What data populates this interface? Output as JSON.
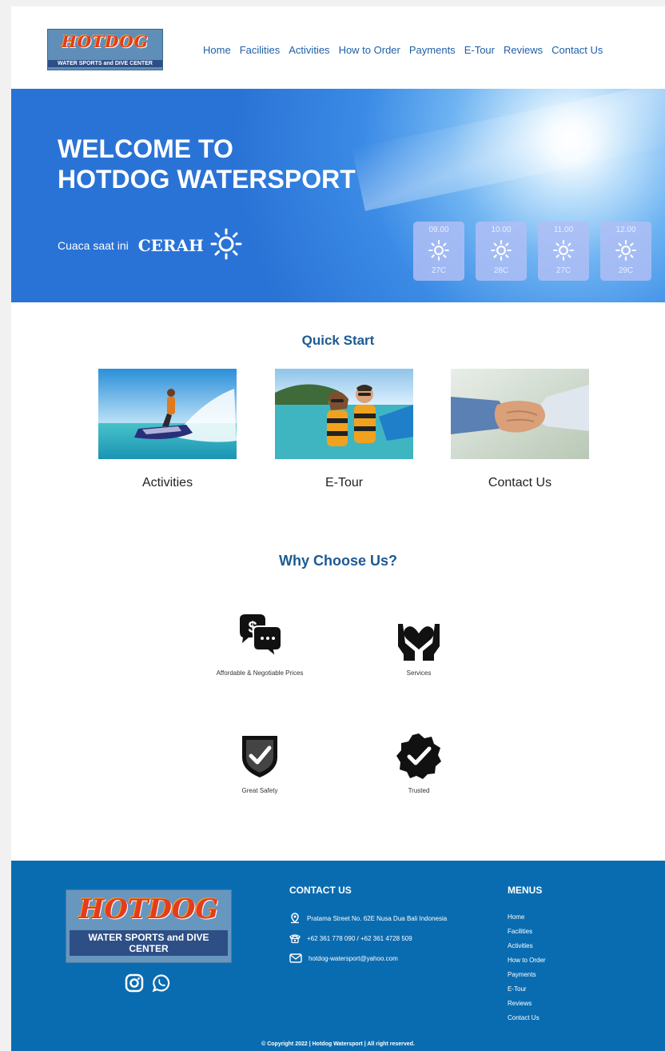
{
  "header": {
    "logo": {
      "brand": "HOTDOG",
      "subtitle": "WATER SPORTS and DIVE CENTER"
    },
    "nav": [
      "Home",
      "Facilities",
      "Activities",
      "How to Order",
      "Payments",
      "E-Tour",
      "Reviews",
      "Contact Us"
    ]
  },
  "hero": {
    "title_line1": "WELCOME TO",
    "title_line2": "HOTDOG WATERSPORT",
    "weather_label": "Cuaca saat ini",
    "weather_value": "CERAH",
    "weather_icon": "sun-icon",
    "forecast": [
      {
        "time": "09.00",
        "temp": "27C"
      },
      {
        "time": "10.00",
        "temp": "28C"
      },
      {
        "time": "11.00",
        "temp": "27C"
      },
      {
        "time": "12.00",
        "temp": "29C"
      }
    ]
  },
  "quick_start": {
    "title": "Quick Start",
    "cards": [
      {
        "label": "Activities"
      },
      {
        "label": "E-Tour"
      },
      {
        "label": "Contact Us"
      }
    ]
  },
  "why_choose_us": {
    "title": "Why Choose Us?",
    "features": [
      {
        "icon": "price-chat-icon",
        "label": "Affordable & Negotiable Prices"
      },
      {
        "icon": "heart-hands-icon",
        "label": "Services"
      },
      {
        "icon": "shield-check-icon",
        "label": "Great Safety"
      },
      {
        "icon": "verified-badge-icon",
        "label": "Trusted"
      }
    ]
  },
  "footer": {
    "logo": {
      "brand": "HOTDOG",
      "subtitle": "WATER SPORTS and DIVE CENTER"
    },
    "social": [
      "instagram-icon",
      "whatsapp-icon"
    ],
    "contact_title": "CONTACT US",
    "address": "Pratama Street No. 62E Nusa Dua Bali Indonesia",
    "phone": "+62 361 778 090 / +62 361 4728 509",
    "email": "hotdog-watersport@yahoo.com",
    "menus_title": "MENUS",
    "menus": [
      "Home",
      "Facilities",
      "Activities",
      "How to Order",
      "Payments",
      "E-Tour",
      "Reviews",
      "Contact Us"
    ],
    "copyright": "© Copyright 2022 | Hotdog Watersport | All right reserved."
  },
  "colors": {
    "nav_link": "#1f5fa6",
    "heading": "#1d5a93",
    "footer_bg": "#0a6cb0",
    "hero_blue": "#3b8be6"
  }
}
